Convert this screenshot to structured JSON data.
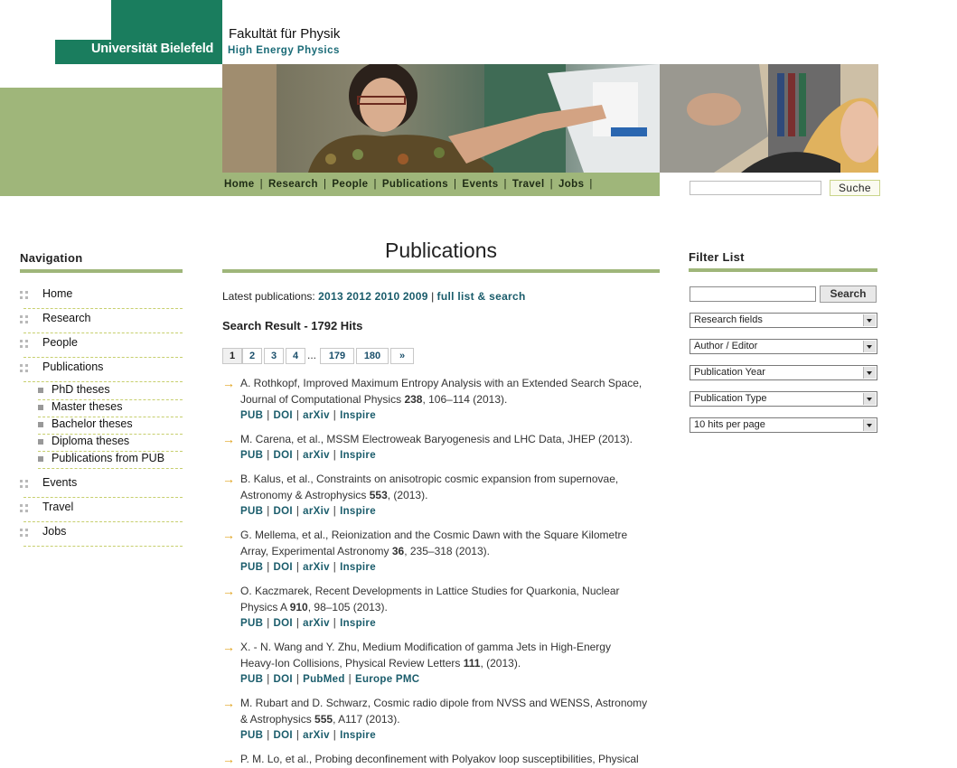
{
  "header": {
    "logo_text": "Universität Bielefeld",
    "faculty": "Fakultät für Physik",
    "group": "High Energy Physics"
  },
  "topnav": [
    "Home",
    "Research",
    "People",
    "Publications",
    "Events",
    "Travel",
    "Jobs"
  ],
  "site_search": {
    "button": "Suche",
    "value": ""
  },
  "sidebar": {
    "heading": "Navigation",
    "items": [
      {
        "label": "Home"
      },
      {
        "label": "Research"
      },
      {
        "label": "People"
      },
      {
        "label": "Publications"
      },
      {
        "label": "Events"
      },
      {
        "label": "Travel"
      },
      {
        "label": "Jobs"
      }
    ],
    "sub_items": [
      "PhD theses",
      "Master theses",
      "Bachelor theses",
      "Diploma theses",
      "Publications from PUB"
    ]
  },
  "main": {
    "title": "Publications",
    "latest_prefix": "Latest publications:",
    "latest_years": [
      "2013",
      "2012",
      "2010",
      "2009"
    ],
    "full_list": "full list & search",
    "search_result": "Search Result - 1792 Hits",
    "pager": [
      "1",
      "2",
      "3",
      "4",
      "...",
      "179",
      "180",
      "»"
    ],
    "publications": [
      {
        "line1": "A. Rothkopf, Improved Maximum Entropy Analysis with an Extended Search Space,",
        "line2_pre": "Journal of Computational Physics ",
        "bold": "238",
        "line2_post": ", 106–114 (2013).",
        "links": [
          "PUB",
          "DOI",
          "arXiv",
          "Inspire"
        ]
      },
      {
        "line1": "M. Carena, et al., MSSM Electroweak Baryogenesis and LHC Data, JHEP (2013).",
        "line2_pre": "",
        "bold": "",
        "line2_post": "",
        "links": [
          "PUB",
          "DOI",
          "arXiv",
          "Inspire"
        ]
      },
      {
        "line1": "B. Kalus, et al., Constraints on anisotropic cosmic expansion from supernovae,",
        "line2_pre": "Astronomy & Astrophysics ",
        "bold": "553",
        "line2_post": ", (2013).",
        "links": [
          "PUB",
          "DOI",
          "arXiv",
          "Inspire"
        ]
      },
      {
        "line1": "G. Mellema, et al., Reionization and the Cosmic Dawn with the Square Kilometre",
        "line2_pre": "Array, Experimental Astronomy ",
        "bold": "36",
        "line2_post": ", 235–318 (2013).",
        "links": [
          "PUB",
          "DOI",
          "arXiv",
          "Inspire"
        ]
      },
      {
        "line1": "O. Kaczmarek, Recent Developments in Lattice Studies for Quarkonia, Nuclear",
        "line2_pre": "Physics A ",
        "bold": "910",
        "line2_post": ", 98–105 (2013).",
        "links": [
          "PUB",
          "DOI",
          "arXiv",
          "Inspire"
        ]
      },
      {
        "line1": "X. - N. Wang and Y. Zhu, Medium Modification of gamma Jets in High-Energy",
        "line2_pre": "Heavy-Ion Collisions, Physical Review Letters ",
        "bold": "111",
        "line2_post": ", (2013).",
        "links": [
          "PUB",
          "DOI",
          "PubMed",
          "Europe PMC"
        ]
      },
      {
        "line1": "M. Rubart and D. Schwarz, Cosmic radio dipole from NVSS and WENSS, Astronomy",
        "line2_pre": "& Astrophysics ",
        "bold": "555",
        "line2_post": ", A117 (2013).",
        "links": [
          "PUB",
          "DOI",
          "arXiv",
          "Inspire"
        ]
      },
      {
        "line1": "P. M. Lo, et al., Probing deconfinement with Polyakov loop susceptibilities, Physical",
        "line2_pre": "",
        "bold": "",
        "line2_post": "",
        "links": []
      }
    ]
  },
  "filter": {
    "heading": "Filter List",
    "button": "Search",
    "value": "",
    "selects": [
      "Research fields",
      "Author / Editor",
      "Publication Year",
      "Publication Type",
      "10 hits per page"
    ]
  },
  "colors": {
    "brand_green": "#1a7d5e",
    "olive": "#9fb67a",
    "link": "#1a5c6b",
    "arrow": "#e0a31d"
  }
}
